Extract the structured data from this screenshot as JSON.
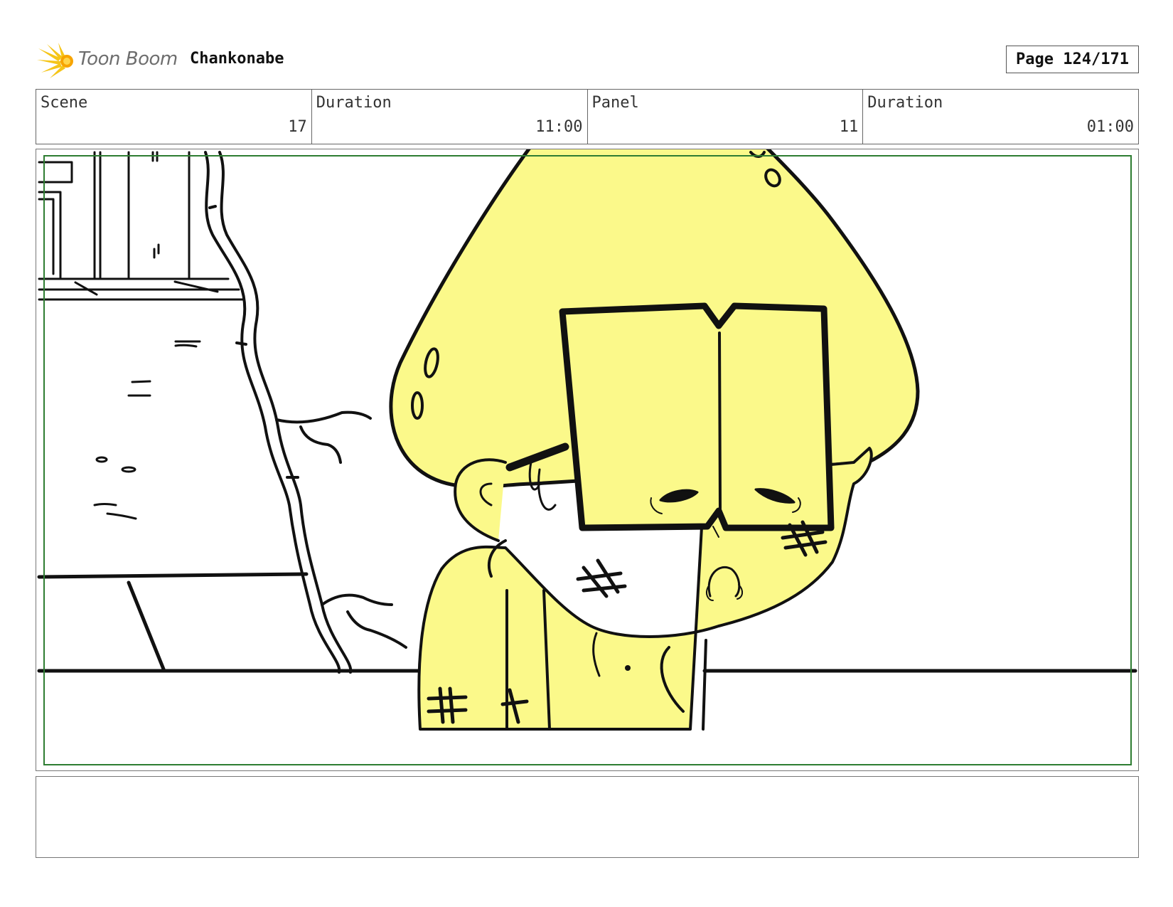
{
  "header": {
    "logo_text": "Toon Boom",
    "project_title": "Chankonabe",
    "page_label": "Page 124/171"
  },
  "info": {
    "scene": {
      "label": "Scene",
      "value": "17"
    },
    "scene_duration": {
      "label": "Duration",
      "value": "11:00"
    },
    "panel": {
      "label": "Panel",
      "value": "11"
    },
    "panel_duration": {
      "label": "Duration",
      "value": "01:00"
    }
  },
  "colors": {
    "character_fill": "#fbf98a",
    "safe_area": "#2e7d32",
    "logo_accent": "#f5c518"
  },
  "notes": {
    "text": ""
  }
}
